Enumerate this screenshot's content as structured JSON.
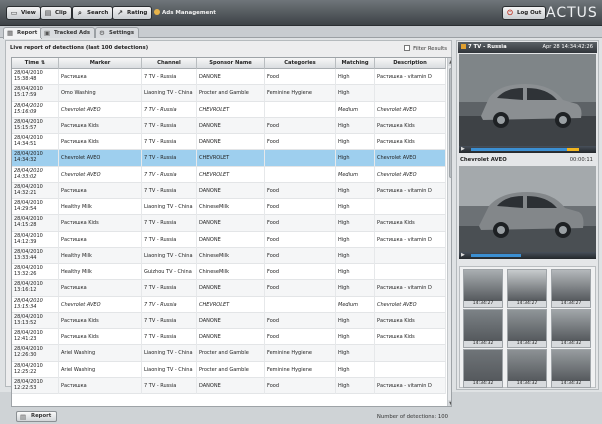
{
  "toolbar": {
    "view": "View",
    "clip": "Clip",
    "search": "Search",
    "rating": "Rating",
    "ads_management": "Ads Management",
    "logout": "Log Out",
    "logo": "ACTUS"
  },
  "tabs": [
    {
      "label": "Report",
      "active": true
    },
    {
      "label": "Tracked Ads",
      "active": false
    },
    {
      "label": "Settings",
      "active": false
    }
  ],
  "report": {
    "heading": "Live report of detections (last 100 detections)",
    "filter_label": "Filter Results",
    "columns": [
      "Time",
      "Marker",
      "Channel",
      "Sponsor Name",
      "Categories",
      "Matching",
      "Description"
    ],
    "rows": [
      {
        "time": "28/04/2010 15:38:48",
        "marker": "Растишка",
        "channel": "7 TV - Russia",
        "sponsor": "DANONE",
        "category": "Food",
        "matching": "High",
        "description": "Растишка - vitamin D"
      },
      {
        "time": "28/04/2010 15:17:59",
        "marker": "Omo Washing",
        "channel": "Liaoning TV - China",
        "sponsor": "Procter and Gamble",
        "category": "Feminine Hygiene",
        "matching": "High",
        "description": ""
      },
      {
        "time": "28/04/2010 15:16:09",
        "marker": "Chevrolet AVEO",
        "channel": "7 TV - Russia",
        "sponsor": "CHEVROLET",
        "category": "",
        "matching": "Medium",
        "description": "Chevrolet AVEO"
      },
      {
        "time": "28/04/2010 15:15:57",
        "marker": "Растишка Kids",
        "channel": "7 TV - Russia",
        "sponsor": "DANONE",
        "category": "Food",
        "matching": "High",
        "description": "Растишка Kids"
      },
      {
        "time": "28/04/2010 14:34:51",
        "marker": "Растишка Kids",
        "channel": "7 TV - Russia",
        "sponsor": "DANONE",
        "category": "Food",
        "matching": "High",
        "description": "Растишка Kids"
      },
      {
        "time": "28/04/2010 14:34:32",
        "marker": "Chevrolet AVEO",
        "channel": "7 TV - Russia",
        "sponsor": "CHEVROLET",
        "category": "",
        "matching": "High",
        "description": "Chevrolet AVEO"
      },
      {
        "time": "28/04/2010 14:33:02",
        "marker": "Chevrolet AVEO",
        "channel": "7 TV - Russia",
        "sponsor": "CHEVROLET",
        "category": "",
        "matching": "Medium",
        "description": "Chevrolet AVEO"
      },
      {
        "time": "28/04/2010 14:32:21",
        "marker": "Растишка",
        "channel": "7 TV - Russia",
        "sponsor": "DANONE",
        "category": "Food",
        "matching": "High",
        "description": "Растишка - vitamin D"
      },
      {
        "time": "28/04/2010 14:29:54",
        "marker": "Healthy Milk",
        "channel": "Liaoning TV - China",
        "sponsor": "ChineseMilk",
        "category": "Food",
        "matching": "High",
        "description": ""
      },
      {
        "time": "28/04/2010 14:15:28",
        "marker": "Растишка Kids",
        "channel": "7 TV - Russia",
        "sponsor": "DANONE",
        "category": "Food",
        "matching": "High",
        "description": "Растишка Kids"
      },
      {
        "time": "28/04/2010 14:12:39",
        "marker": "Растишка",
        "channel": "7 TV - Russia",
        "sponsor": "DANONE",
        "category": "Food",
        "matching": "High",
        "description": "Растишка - vitamin D"
      },
      {
        "time": "28/04/2010 13:33:44",
        "marker": "Healthy Milk",
        "channel": "Liaoning TV - China",
        "sponsor": "ChineseMilk",
        "category": "Food",
        "matching": "High",
        "description": ""
      },
      {
        "time": "28/04/2010 13:32:26",
        "marker": "Healthy Milk",
        "channel": "Guizhou TV - China",
        "sponsor": "ChineseMilk",
        "category": "Food",
        "matching": "High",
        "description": ""
      },
      {
        "time": "28/04/2010 13:16:12",
        "marker": "Растишка",
        "channel": "7 TV - Russia",
        "sponsor": "DANONE",
        "category": "Food",
        "matching": "High",
        "description": "Растишка - vitamin D"
      },
      {
        "time": "28/04/2010 13:15:34",
        "marker": "Chevrolet AVEO",
        "channel": "7 TV - Russia",
        "sponsor": "CHEVROLET",
        "category": "",
        "matching": "Medium",
        "description": "Chevrolet AVEO"
      },
      {
        "time": "28/04/2010 13:13:52",
        "marker": "Растишка Kids",
        "channel": "7 TV - Russia",
        "sponsor": "DANONE",
        "category": "Food",
        "matching": "High",
        "description": "Растишка Kids"
      },
      {
        "time": "28/04/2010 12:41:23",
        "marker": "Растишка Kids",
        "channel": "7 TV - Russia",
        "sponsor": "DANONE",
        "category": "Food",
        "matching": "High",
        "description": "Растишка Kids"
      },
      {
        "time": "28/04/2010 12:26:30",
        "marker": "Ariel Washing",
        "channel": "Liaoning TV - China",
        "sponsor": "Procter and Gamble",
        "category": "Feminine Hygiene",
        "matching": "High",
        "description": ""
      },
      {
        "time": "28/04/2010 12:25:22",
        "marker": "Ariel Washing",
        "channel": "Liaoning TV - China",
        "sponsor": "Procter and Gamble",
        "category": "Feminine Hygiene",
        "matching": "High",
        "description": ""
      },
      {
        "time": "28/04/2010 12:22:53",
        "marker": "Растишка",
        "channel": "7 TV - Russia",
        "sponsor": "DANONE",
        "category": "Food",
        "matching": "High",
        "description": "Растишка - vitamin D"
      }
    ],
    "selected_row": 5,
    "report_button": "Report",
    "count_text": "Number of detections: 100"
  },
  "preview": {
    "channel": "7 TV - Russia",
    "datetime": "Apr 28 14:34:42:26",
    "match_label": "Chevrolet AVEO",
    "match_time": "00:00:11",
    "thumbs": [
      "14:34:27",
      "14:34:27",
      "14:34:27",
      "14:34:32",
      "14:34:32",
      "14:34:32",
      "14:34:32",
      "14:34:32",
      "14:34:32"
    ]
  },
  "colors": {
    "selected_row": "#9ecfee",
    "header_dark": "#3d4246",
    "progress": "#3b8fd2"
  }
}
